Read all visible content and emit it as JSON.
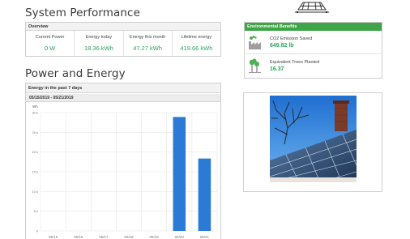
{
  "headings": {
    "system_performance": "System Performance",
    "power_and_energy": "Power and Energy"
  },
  "overview": {
    "title": "Overview",
    "metrics": [
      {
        "label": "Current Power",
        "value": "0 W"
      },
      {
        "label": "Energy today",
        "value": "18.36 kWh"
      },
      {
        "label": "Energy this month",
        "value": "47.27 kWh"
      },
      {
        "label": "Lifetime energy",
        "value": "419.66 kWh"
      }
    ]
  },
  "environment": {
    "title": "Environmental Benefits",
    "items": [
      {
        "label": "CO2 Emission Saved",
        "value": "649.82 lb",
        "icon": "co2-factory-icon"
      },
      {
        "label": "Equivalent Trees Planted",
        "value": "16.37",
        "icon": "tree-icon"
      }
    ]
  },
  "chart_panel": {
    "title": "Energy in the past 7 days",
    "date_range": "05/15/2019 - 05/21/2019"
  },
  "chart_data": {
    "type": "bar",
    "ylabel": "Wh",
    "ylim": [
      0,
      30000
    ],
    "y_ticks": [
      "0",
      "5 k",
      "10 k",
      "15 k",
      "20 k",
      "25 k",
      "30 k"
    ],
    "y_tick_values": [
      0,
      5000,
      10000,
      15000,
      20000,
      25000,
      30000
    ],
    "categories": [
      "05/15",
      "05/16",
      "05/17",
      "05/18",
      "05/19",
      "05/20",
      "05/21"
    ],
    "values": [
      0,
      0,
      0,
      0,
      0,
      28900,
      18360
    ],
    "bar_color": "#2b7bd6",
    "grid": true
  },
  "colors": {
    "accent_green": "#2aa55f",
    "header_green": "#3ea447",
    "bar_blue": "#2b7bd6"
  }
}
